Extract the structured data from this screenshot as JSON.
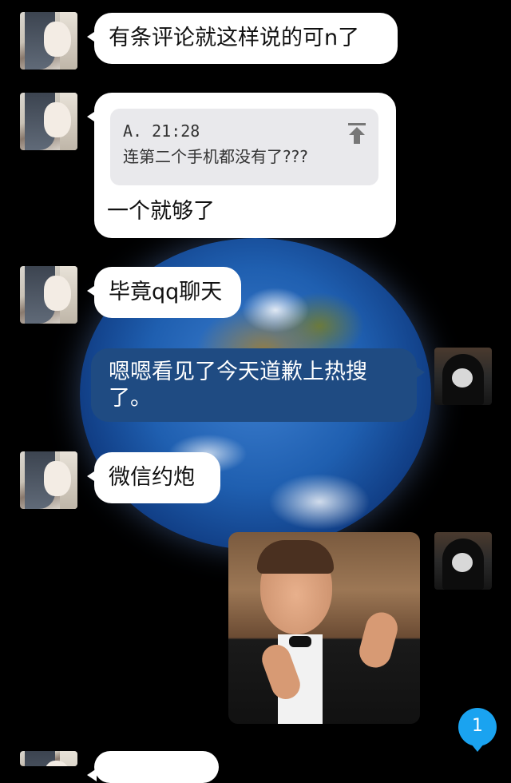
{
  "messages": [
    {
      "text": "有条评论就这样说的可n了"
    },
    {
      "quote_meta": "A. 21:28",
      "quote_text": "连第二个手机都没有了???",
      "text": "一个就够了"
    },
    {
      "text": "毕竟qq聊天"
    },
    {
      "text": "嗯嗯看见了今天道歉上热搜了。"
    },
    {
      "text": "微信约炮"
    }
  ],
  "unread_badge": "1",
  "colors": {
    "background": "#000000",
    "left_bubble": "#ffffff",
    "right_bubble": "#1f4b82",
    "badge": "#1aa3f0"
  }
}
